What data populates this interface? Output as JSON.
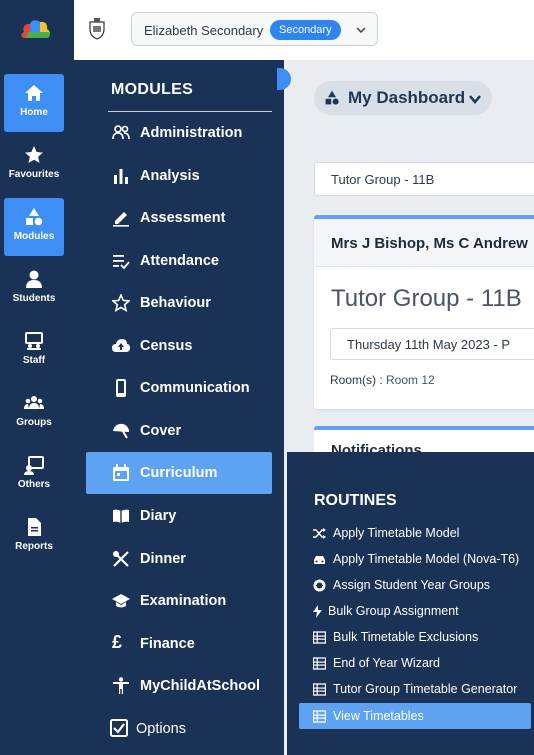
{
  "school": {
    "name": "Elizabeth Secondary",
    "badge": "Secondary"
  },
  "rail": [
    {
      "label": "Home",
      "icon": "home-icon",
      "active": true
    },
    {
      "label": "Favourites",
      "icon": "star-icon"
    },
    {
      "label": "Modules",
      "icon": "shapes-icon",
      "active": true
    },
    {
      "label": "Students",
      "icon": "user-icon"
    },
    {
      "label": "Staff",
      "icon": "staff-icon"
    },
    {
      "label": "Groups",
      "icon": "group-icon"
    },
    {
      "label": "Others",
      "icon": "others-icon"
    },
    {
      "label": "Reports",
      "icon": "report-icon"
    }
  ],
  "modules": {
    "heading": "MODULES",
    "items": [
      {
        "label": "Administration",
        "icon": "people-icon"
      },
      {
        "label": "Analysis",
        "icon": "bar-chart-icon"
      },
      {
        "label": "Assessment",
        "icon": "pen-icon"
      },
      {
        "label": "Attendance",
        "icon": "checklist-icon"
      },
      {
        "label": "Behaviour",
        "icon": "star-outline-icon"
      },
      {
        "label": "Census",
        "icon": "cloud-upload-icon"
      },
      {
        "label": "Communication",
        "icon": "mobile-icon"
      },
      {
        "label": "Cover",
        "icon": "umbrella-icon"
      },
      {
        "label": "Curriculum",
        "icon": "calendar-icon",
        "active": true
      },
      {
        "label": "Diary",
        "icon": "book-icon"
      },
      {
        "label": "Dinner",
        "icon": "cutlery-icon"
      },
      {
        "label": "Examination",
        "icon": "graduation-cap-icon"
      },
      {
        "label": "Finance",
        "icon": "pound-icon"
      },
      {
        "label": "MyChildAtSchool",
        "icon": "child-icon"
      },
      {
        "label": "Options",
        "icon": "checkbox-icon"
      }
    ]
  },
  "dashboard": {
    "title": "My Dashboard",
    "group_select": "Tutor Group - 11B",
    "card": {
      "header": "Mrs J Bishop, Ms C Andrew",
      "title": "Tutor Group - 11B",
      "date": "Thursday 11th May 2023 - P",
      "room_label": "Room(s) :",
      "room_value": "Room 12"
    },
    "notifications": "Notifications"
  },
  "routines": {
    "heading": "ROUTINES",
    "items": [
      {
        "label": "Apply Timetable Model",
        "icon": "shuffle-icon"
      },
      {
        "label": "Apply Timetable Model (Nova-T6)",
        "icon": "car-icon"
      },
      {
        "label": "Assign Student Year Groups",
        "icon": "badge-icon"
      },
      {
        "label": "Bulk Group Assignment",
        "icon": "bolt-icon"
      },
      {
        "label": "Bulk Timetable Exclusions",
        "icon": "table-icon"
      },
      {
        "label": "End of Year Wizard",
        "icon": "table-icon"
      },
      {
        "label": "Tutor Group Timetable Generator",
        "icon": "table-icon"
      },
      {
        "label": "View Timetables",
        "icon": "table-icon",
        "active": true
      }
    ]
  },
  "colors": {
    "navy": "#1a3255",
    "accent": "#3d8ff5",
    "active_item": "#5ea3f2"
  }
}
